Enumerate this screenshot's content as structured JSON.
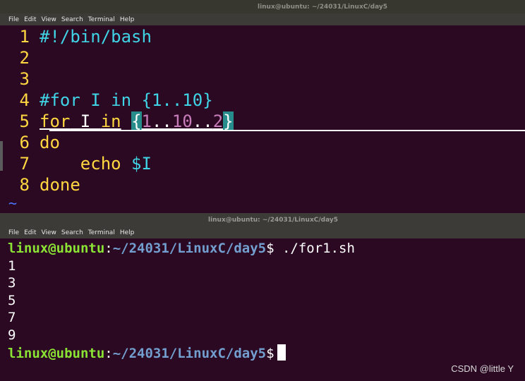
{
  "window1": {
    "title": "linux@ubuntu: ~/24031/LinuxC/day5",
    "menu": [
      "File",
      "Edit",
      "View",
      "Search",
      "Terminal",
      "Help"
    ],
    "editor_lines": [
      {
        "num": "1",
        "text": "#!/bin/bash"
      },
      {
        "num": "2",
        "text": ""
      },
      {
        "num": "3",
        "text": ""
      },
      {
        "num": "4",
        "text": "#for I in {1..10}"
      },
      {
        "num": "5",
        "text": "for I in {1..10..2}"
      },
      {
        "num": "6",
        "text": "do"
      },
      {
        "num": "7",
        "text": "    echo $I"
      },
      {
        "num": "8",
        "text": "done"
      }
    ],
    "tilde": "~"
  },
  "window2": {
    "title": "linux@ubuntu: ~/24031/LinuxC/day5",
    "menu": [
      "File",
      "Edit",
      "View",
      "Search",
      "Terminal",
      "Help"
    ],
    "prompt_user": "linux@ubuntu",
    "prompt_path": "~/24031/LinuxC/day5",
    "prompt_symbol": "$",
    "command": "./for1.sh",
    "output": [
      "1",
      "3",
      "5",
      "7",
      "9"
    ]
  },
  "watermark": "CSDN @little Y",
  "colors": {
    "background": "#2c0922",
    "line_number": "#ffd740",
    "keyword": "#ffd740",
    "comment": "#3fd4e6",
    "number": "#c77dba",
    "prompt_user": "#8ae234",
    "prompt_path": "#729fcf"
  }
}
